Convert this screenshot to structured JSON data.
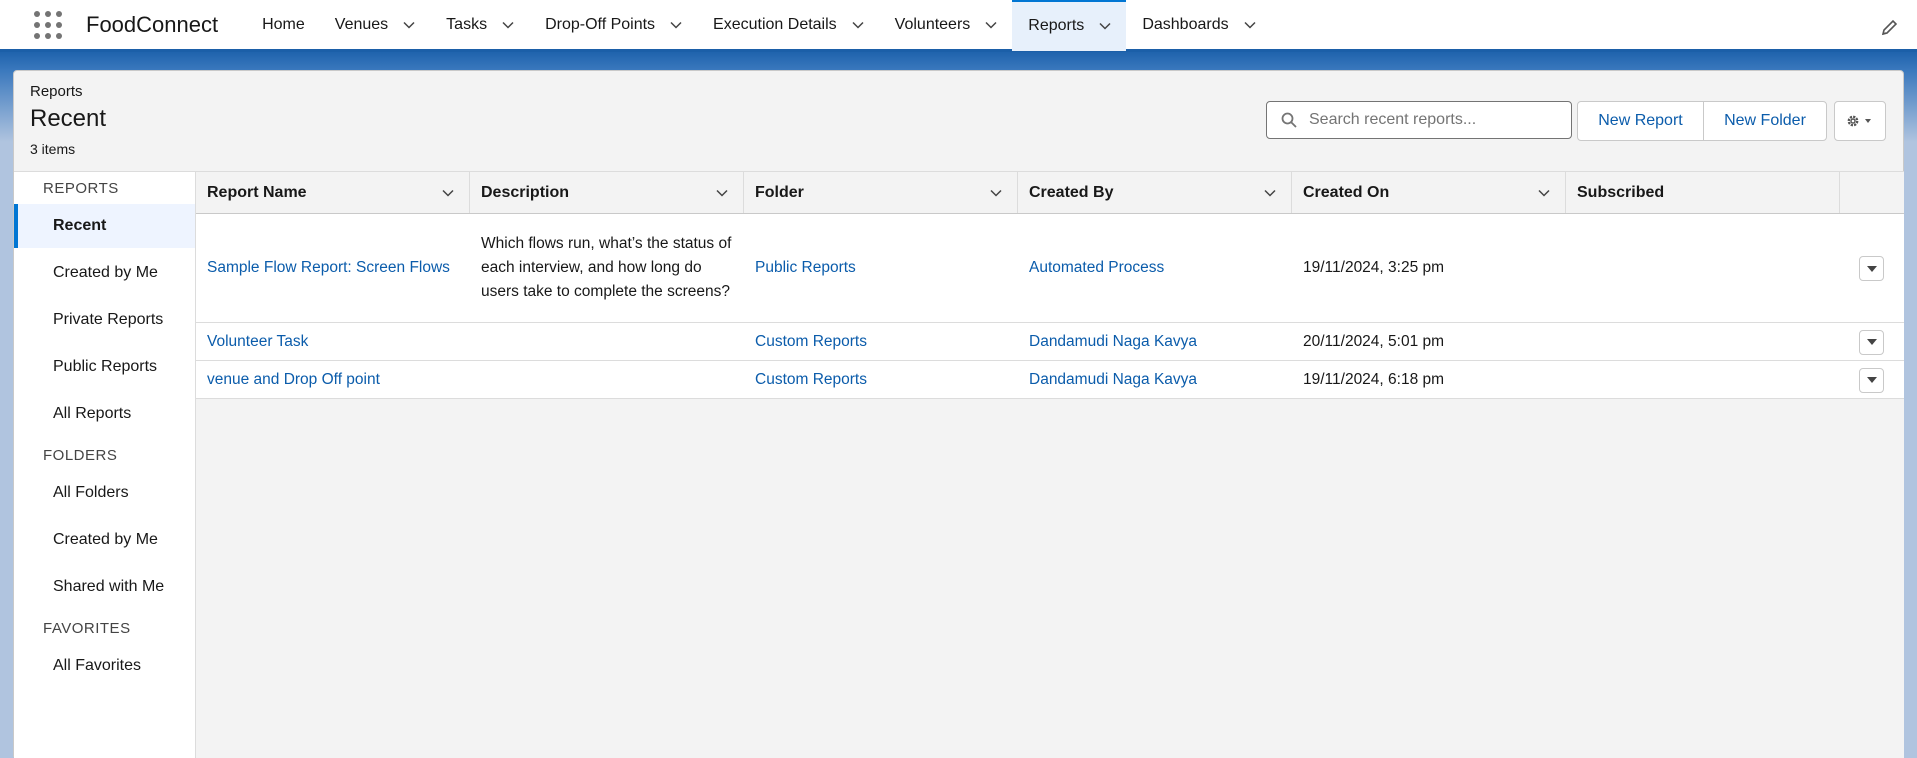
{
  "app": {
    "name": "FoodConnect"
  },
  "nav": {
    "items": [
      {
        "label": "Home",
        "has_menu": false
      },
      {
        "label": "Venues",
        "has_menu": true
      },
      {
        "label": "Tasks",
        "has_menu": true
      },
      {
        "label": "Drop-Off Points",
        "has_menu": true
      },
      {
        "label": "Execution Details",
        "has_menu": true
      },
      {
        "label": "Volunteers",
        "has_menu": true
      },
      {
        "label": "Reports",
        "has_menu": true,
        "active": true
      },
      {
        "label": "Dashboards",
        "has_menu": true
      }
    ]
  },
  "header": {
    "breadcrumb": "Reports",
    "title": "Recent",
    "count": "3 items",
    "search_placeholder": "Search recent reports...",
    "new_report": "New Report",
    "new_folder": "New Folder"
  },
  "sidebar": {
    "sections": [
      {
        "title": "REPORTS",
        "items": [
          "Recent",
          "Created by Me",
          "Private Reports",
          "Public Reports",
          "All Reports"
        ]
      },
      {
        "title": "FOLDERS",
        "items": [
          "All Folders",
          "Created by Me",
          "Shared with Me"
        ]
      },
      {
        "title": "FAVORITES",
        "items": [
          "All Favorites"
        ]
      }
    ],
    "active_item": "Recent"
  },
  "table": {
    "columns": [
      "Report Name",
      "Description",
      "Folder",
      "Created By",
      "Created On",
      "Subscribed"
    ],
    "rows": [
      {
        "name": "Sample Flow Report: Screen Flows",
        "description": "Which flows run, what’s the status of each interview, and how long do users take to complete the screens?",
        "folder": "Public Reports",
        "created_by": "Automated Process",
        "created_on": "19/11/2024, 3:25 pm",
        "subscribed": ""
      },
      {
        "name": "Volunteer Task",
        "description": "",
        "folder": "Custom Reports",
        "created_by": "Dandamudi Naga Kavya",
        "created_on": "20/11/2024, 5:01 pm",
        "subscribed": ""
      },
      {
        "name": "venue and Drop Off point",
        "description": "",
        "folder": "Custom Reports",
        "created_by": "Dandamudi Naga Kavya",
        "created_on": "19/11/2024, 6:18 pm",
        "subscribed": ""
      }
    ]
  },
  "colors": {
    "brand": "#0176d3",
    "link": "#0b5cab",
    "header_band": "#1b5fa8"
  }
}
